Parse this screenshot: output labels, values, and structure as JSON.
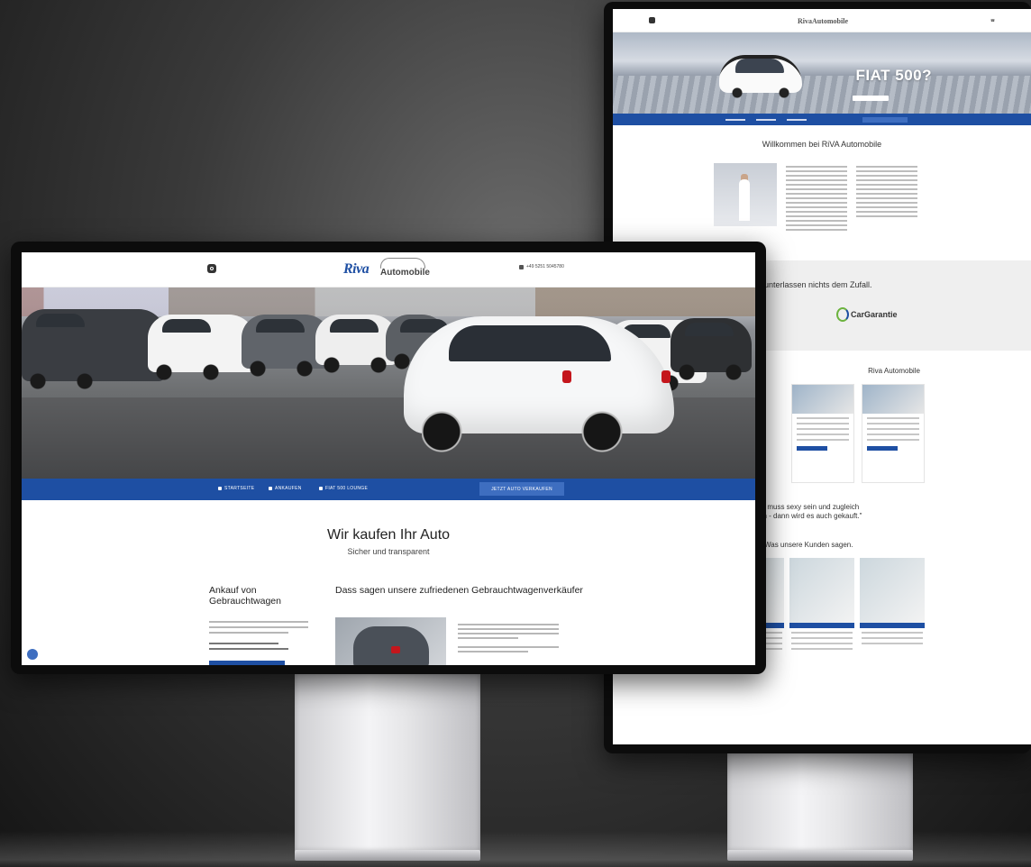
{
  "back_site": {
    "logo_main": "Riva",
    "logo_sub": "Automobile",
    "hero_title": "FIAT 500?",
    "welcome_title": "Willkommen bei RiVA Automobile",
    "partner_title": "unterlassen nichts dem Zufall.",
    "partner_logo": "CarGarantie",
    "section_title": "Riva Automobile",
    "quote_line1": "uto muss sexy sein und zugleich",
    "quote_line2": "ach - dann wird es auch gekauft.\"",
    "reviews_title": "Was unsere Kunden sagen."
  },
  "front_site": {
    "logo_main": "Riva",
    "logo_sub": "Automobile",
    "phone": "+49 5251 5045780",
    "nav": {
      "item1": "STARTSEITE",
      "item2": "ANKAUFEN",
      "item3": "FIAT 500 LOUNGE",
      "cta": "JETZT AUTO VERKAUFEN"
    },
    "intro_title": "Wir kaufen Ihr Auto",
    "intro_subtitle": "Sicher und transparent",
    "col1_title": "Ankauf von Gebrauchtwagen",
    "col2_title": "Dass sagen unsere zufriedenen Gebrauchtwagenverkäufer"
  },
  "colors": {
    "brand_blue": "#1e4fa3",
    "accent_red": "#c4161c",
    "cargarantie_green": "#6cb33e"
  }
}
